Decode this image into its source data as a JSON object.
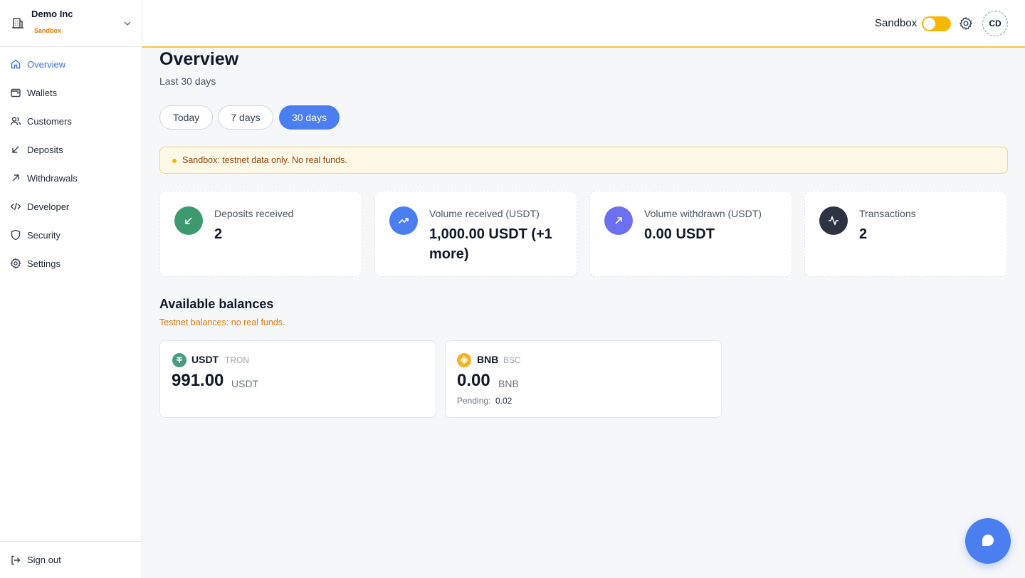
{
  "org": {
    "name": "Demo Inc",
    "badge": "Sandbox"
  },
  "nav": [
    {
      "label": "Overview",
      "icon": "home-icon",
      "active": true
    },
    {
      "label": "Wallets",
      "icon": "wallet-icon"
    },
    {
      "label": "Customers",
      "icon": "users-icon"
    },
    {
      "label": "Deposits",
      "icon": "arrow-down-left-icon"
    },
    {
      "label": "Withdrawals",
      "icon": "arrow-up-right-icon"
    },
    {
      "label": "Developer",
      "icon": "code-icon"
    },
    {
      "label": "Security",
      "icon": "shield-icon"
    },
    {
      "label": "Settings",
      "icon": "gear-icon"
    }
  ],
  "sign_out": "Sign out",
  "topbar": {
    "mode_label": "Sandbox",
    "sandbox_enabled": true,
    "avatar_initials": "CD"
  },
  "page": {
    "title": "Overview",
    "subtitle": "Last 30 days"
  },
  "ranges": [
    {
      "label": "Today"
    },
    {
      "label": "7 days"
    },
    {
      "label": "30 days",
      "active": true
    }
  ],
  "alert": "Sandbox: testnet data only. No real funds.",
  "stats": [
    {
      "label": "Deposits received",
      "value": "2",
      "icon": "arrow-down-left-icon",
      "color": "#3d9a6f"
    },
    {
      "label": "Volume received (USDT)",
      "value": "1,000.00 USDT (+1 more)",
      "icon": "trending-up-icon",
      "color": "#4b7ff0"
    },
    {
      "label": "Volume withdrawn (USDT)",
      "value": "0.00 USDT",
      "icon": "arrow-up-right-icon",
      "color": "#6b6ff0"
    },
    {
      "label": "Transactions",
      "value": "2",
      "icon": "activity-icon",
      "color": "#2d3340"
    }
  ],
  "balances": {
    "title": "Available balances",
    "subtitle": "Testnet balances: no real funds.",
    "items": [
      {
        "coin": "USDT",
        "network": "TRON",
        "amount": "991.00",
        "unit": "USDT",
        "icon": "tether-icon",
        "color": "#4a9b7f"
      },
      {
        "coin": "BNB",
        "network": "BSC",
        "amount": "0.00",
        "unit": "BNB",
        "icon": "bnb-icon",
        "color": "#f0b429",
        "pending_label": "Pending:",
        "pending_value": "0.02"
      }
    ]
  },
  "colors": {
    "accent": "#4b7ff0",
    "sandbox": "#f5b800"
  }
}
